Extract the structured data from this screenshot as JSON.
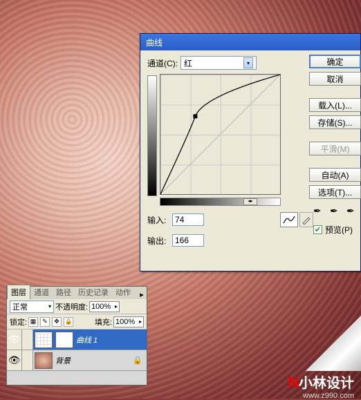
{
  "dialog": {
    "title": "曲线",
    "channel_label": "通道(C):",
    "channel_value": "红",
    "input_label": "输入:",
    "input_value": "74",
    "output_label": "输出:",
    "output_value": "166",
    "btn_ok": "确定",
    "btn_cancel": "取消",
    "btn_load": "载入(L)...",
    "btn_save": "存储(S)...",
    "btn_smooth": "平滑(M)",
    "btn_auto": "自动(A)",
    "btn_options": "选项(T)...",
    "preview_label": "预览(P)",
    "preview_checked": true
  },
  "layers": {
    "tabs": [
      "图层",
      "通道",
      "路径",
      "历史记录",
      "动作"
    ],
    "active_tab": 0,
    "blend_label": "正常",
    "opacity_label": "不透明度:",
    "opacity_value": "100%",
    "lock_label": "锁定:",
    "fill_label": "填充:",
    "fill_value": "100%",
    "items": [
      {
        "name": "曲线 1",
        "active": true,
        "type": "adjustment"
      },
      {
        "name": "背景",
        "active": false,
        "type": "image",
        "locked": true
      }
    ]
  },
  "watermark": {
    "text": "小林设计",
    "url": "www.z990.com"
  },
  "chart_data": {
    "type": "line",
    "title": "曲线",
    "xlabel": "输入",
    "ylabel": "输出",
    "xlim": [
      0,
      255
    ],
    "ylim": [
      0,
      255
    ],
    "series": [
      {
        "name": "红",
        "points": [
          [
            0,
            0
          ],
          [
            74,
            166
          ],
          [
            255,
            255
          ]
        ]
      }
    ],
    "control_point": {
      "input": 74,
      "output": 166
    }
  }
}
